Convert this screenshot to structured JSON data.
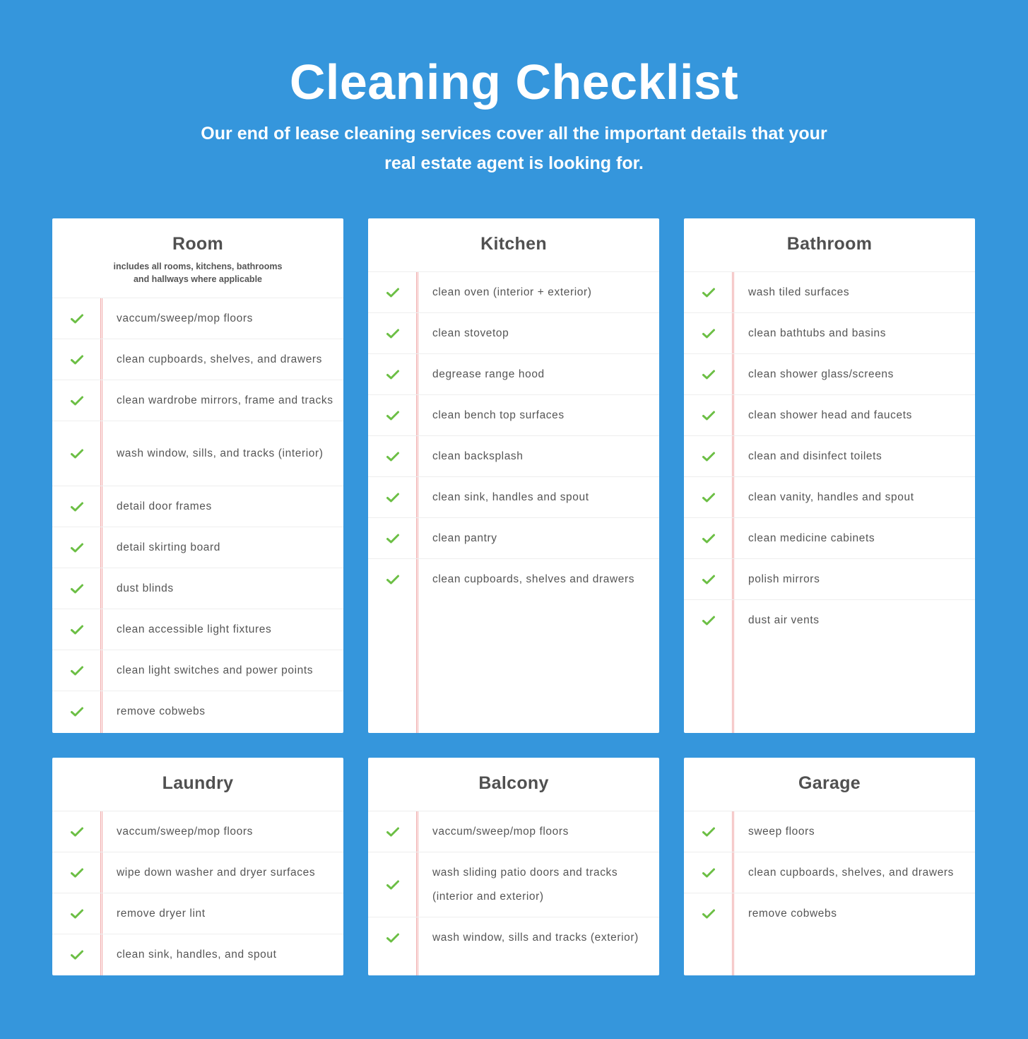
{
  "header": {
    "title": "Cleaning Checklist",
    "subtitle": "Our end of lease cleaning services cover all the important details that your real estate agent is looking for."
  },
  "colors": {
    "background": "#3596dc",
    "check": "#6cbf45",
    "divider_red": "#f0a8a8"
  },
  "cards": {
    "room": {
      "title": "Room",
      "note": "includes all rooms, kitchens, bathrooms and hallways where applicable",
      "items": [
        "vaccum/sweep/mop floors",
        "clean cupboards, shelves, and drawers",
        "clean wardrobe mirrors, frame and tracks",
        "wash window, sills, and tracks (interior)",
        "detail door frames",
        "detail skirting board",
        "dust blinds",
        "clean accessible light fixtures",
        "clean light switches and power points",
        "remove cobwebs"
      ]
    },
    "kitchen": {
      "title": "Kitchen",
      "items": [
        "clean oven (interior + exterior)",
        "clean stovetop",
        "degrease range hood",
        "clean bench top surfaces",
        "clean backsplash",
        "clean sink, handles and spout",
        "clean pantry",
        "clean cupboards, shelves and drawers"
      ]
    },
    "bathroom": {
      "title": "Bathroom",
      "items": [
        "wash tiled surfaces",
        "clean bathtubs and basins",
        "clean shower glass/screens",
        "clean shower head and faucets",
        "clean and disinfect toilets",
        "clean vanity, handles and spout",
        "clean medicine cabinets",
        "polish mirrors",
        "dust air vents"
      ]
    },
    "laundry": {
      "title": "Laundry",
      "items": [
        "vaccum/sweep/mop floors",
        "wipe down washer and dryer surfaces",
        "remove dryer lint",
        "clean sink, handles, and spout"
      ]
    },
    "balcony": {
      "title": "Balcony",
      "items": [
        "vaccum/sweep/mop floors",
        "wash sliding patio doors and tracks (interior and exterior)",
        "wash window, sills and tracks (exterior)"
      ]
    },
    "garage": {
      "title": "Garage",
      "items": [
        "sweep floors",
        "clean cupboards, shelves, and drawers",
        "remove cobwebs"
      ]
    }
  }
}
